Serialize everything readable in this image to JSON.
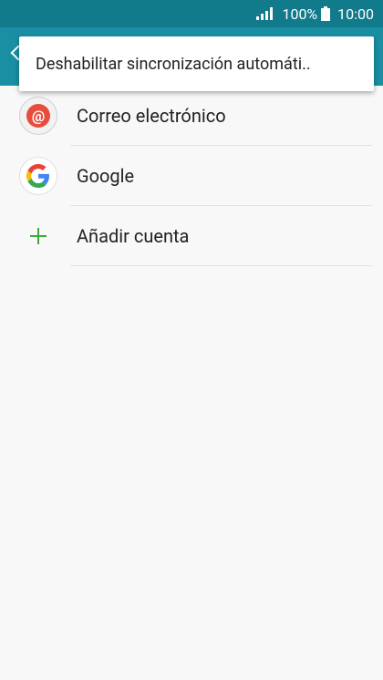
{
  "status_bar": {
    "battery": "100%",
    "time": "10:00",
    "icons": [
      "signal-icon",
      "battery-icon"
    ]
  },
  "popup_menu": {
    "item": "Deshabilitar sincronización automáti.."
  },
  "accounts": [
    {
      "label": "Correo electrónico",
      "icon": "email-icon"
    },
    {
      "label": "Google",
      "icon": "google-icon"
    },
    {
      "label": "Añadir cuenta",
      "icon": "plus-icon"
    }
  ],
  "colors": {
    "status_bar": "#117a8b",
    "app_bar": "#1a8fa3",
    "background": "#f8f8f8",
    "accent_green": "#3fa83c",
    "email_red": "#e74c3c"
  }
}
